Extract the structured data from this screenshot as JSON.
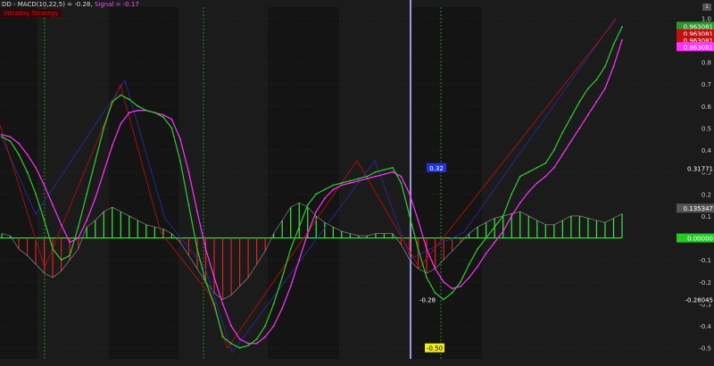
{
  "header": {
    "symbol_text": "DD - MACD(10,22,5) = -0.28,",
    "signal_text": "Signal = -0.17",
    "sub_label": "Intraday Strategy",
    "corner": "1"
  },
  "colors": {
    "background": "#1b1b1b",
    "macd": "#33cc33",
    "signal": "#ff33ff",
    "histogram_pos": "#33ee33",
    "histogram_neg": "#e02020",
    "price_blue": "#2a2a9a",
    "price_red": "#b01010",
    "grid": "#3a3a3a"
  },
  "chart_data": {
    "type": "line",
    "title": "",
    "ylim": [
      -0.55,
      1.05
    ],
    "y_ticks": [
      1.0,
      0.9,
      0.8,
      0.7,
      0.6,
      0.5,
      0.4,
      0.3,
      0.2,
      0.1,
      0.0,
      -0.1,
      -0.2,
      -0.3,
      -0.4,
      -0.5
    ],
    "x": [
      0,
      1,
      2,
      3,
      4,
      5,
      6,
      7,
      8,
      9,
      10,
      11,
      12,
      13,
      14,
      15,
      16,
      17,
      18,
      19,
      20,
      21,
      22,
      23,
      24,
      25,
      26,
      27,
      28,
      29,
      30,
      31,
      32,
      33,
      34,
      35,
      36,
      37,
      38,
      39,
      40,
      41,
      42,
      43,
      44,
      45,
      46,
      47,
      48,
      49,
      50,
      51,
      52,
      53,
      54,
      55,
      56,
      57,
      58,
      59,
      60,
      61,
      62,
      63,
      64,
      65,
      66,
      67,
      68,
      69,
      70,
      71,
      72,
      73,
      74,
      75,
      76,
      77,
      78,
      79,
      80,
      81,
      82,
      83,
      84,
      85,
      86,
      87,
      88,
      89,
      90,
      91,
      92,
      93,
      94,
      95,
      96,
      97,
      98,
      99,
      100
    ],
    "series": [
      {
        "key": "macd",
        "values": [
          0.46,
          0.44,
          0.38,
          0.3,
          0.2,
          0.08,
          -0.05,
          -0.1,
          -0.08,
          0.05,
          0.2,
          0.35,
          0.5,
          0.62,
          0.65,
          0.63,
          0.6,
          0.58,
          0.57,
          0.55,
          0.5,
          0.35,
          0.15,
          -0.05,
          -0.2,
          -0.3,
          -0.45,
          -0.48,
          -0.5,
          -0.49,
          -0.46,
          -0.4,
          -0.3,
          -0.18,
          -0.05,
          0.05,
          0.15,
          0.2,
          0.22,
          0.24,
          0.25,
          0.26,
          0.27,
          0.28,
          0.3,
          0.31,
          0.32,
          0.25,
          0.1,
          -0.05,
          -0.18,
          -0.25,
          -0.28,
          -0.25,
          -0.2,
          -0.12,
          -0.05,
          0.0,
          0.05,
          0.1,
          0.2,
          0.28,
          0.3,
          0.32,
          0.34,
          0.4,
          0.48,
          0.55,
          0.62,
          0.68,
          0.72,
          0.78,
          0.88,
          0.96
        ]
      },
      {
        "key": "signal",
        "values": [
          0.47,
          0.46,
          0.43,
          0.38,
          0.32,
          0.24,
          0.15,
          0.06,
          -0.02,
          0.0,
          0.08,
          0.18,
          0.3,
          0.42,
          0.52,
          0.57,
          0.58,
          0.58,
          0.57,
          0.56,
          0.54,
          0.45,
          0.3,
          0.12,
          -0.05,
          -0.18,
          -0.3,
          -0.4,
          -0.46,
          -0.48,
          -0.48,
          -0.45,
          -0.4,
          -0.32,
          -0.22,
          -0.1,
          0.02,
          0.12,
          0.18,
          0.22,
          0.24,
          0.25,
          0.26,
          0.27,
          0.28,
          0.29,
          0.3,
          0.28,
          0.2,
          0.08,
          -0.05,
          -0.14,
          -0.2,
          -0.23,
          -0.22,
          -0.18,
          -0.13,
          -0.07,
          -0.02,
          0.03,
          0.1,
          0.16,
          0.21,
          0.25,
          0.28,
          0.32,
          0.38,
          0.44,
          0.5,
          0.56,
          0.62,
          0.68,
          0.78,
          0.9
        ]
      },
      {
        "key": "histogram",
        "values": [
          0.02,
          0.01,
          -0.05,
          -0.08,
          -0.12,
          -0.16,
          -0.18,
          -0.15,
          -0.1,
          -0.05,
          0.05,
          0.08,
          0.12,
          0.14,
          0.12,
          0.1,
          0.08,
          0.06,
          0.05,
          0.04,
          0.02,
          -0.02,
          -0.08,
          -0.14,
          -0.2,
          -0.25,
          -0.28,
          -0.26,
          -0.22,
          -0.18,
          -0.12,
          -0.06,
          0.02,
          0.08,
          0.14,
          0.16,
          0.14,
          0.1,
          0.07,
          0.05,
          0.03,
          0.02,
          0.01,
          0.01,
          0.02,
          0.02,
          0.02,
          -0.03,
          -0.1,
          -0.14,
          -0.16,
          -0.14,
          -0.1,
          -0.06,
          -0.02,
          0.02,
          0.05,
          0.07,
          0.09,
          0.1,
          0.11,
          0.12,
          0.1,
          0.08,
          0.06,
          0.06,
          0.08,
          0.1,
          0.1,
          0.09,
          0.08,
          0.07,
          0.09,
          0.11
        ]
      }
    ],
    "price_labels": [
      {
        "value": 0.96308,
        "text": "0.963081",
        "color": "#2a9a2a"
      },
      {
        "value": 0.93,
        "text": "0.963081",
        "color": "#c01010"
      },
      {
        "value": 0.9,
        "text": "0.963081",
        "color": "#c01010"
      },
      {
        "value": 0.87,
        "text": "0.963081",
        "color": "#ff33ff"
      },
      {
        "value": 0.31771,
        "text": "0.31771",
        "color": "#1b1b1b"
      },
      {
        "value": 0.13534,
        "text": "0.135347",
        "color": "#555555"
      },
      {
        "value": 0.0,
        "text": "0.00000",
        "color": "#22cc22"
      },
      {
        "value": -0.28045,
        "text": "-0.28045",
        "color": "#1b1b1b"
      }
    ],
    "annotations": [
      {
        "text": "0.32",
        "value": 0.32,
        "bg": "#2233dd"
      },
      {
        "text": "-0.28",
        "value": -0.28,
        "bg": "transparent"
      },
      {
        "text": "-0.50",
        "value": -0.5,
        "bg": "#eeee22"
      }
    ]
  }
}
